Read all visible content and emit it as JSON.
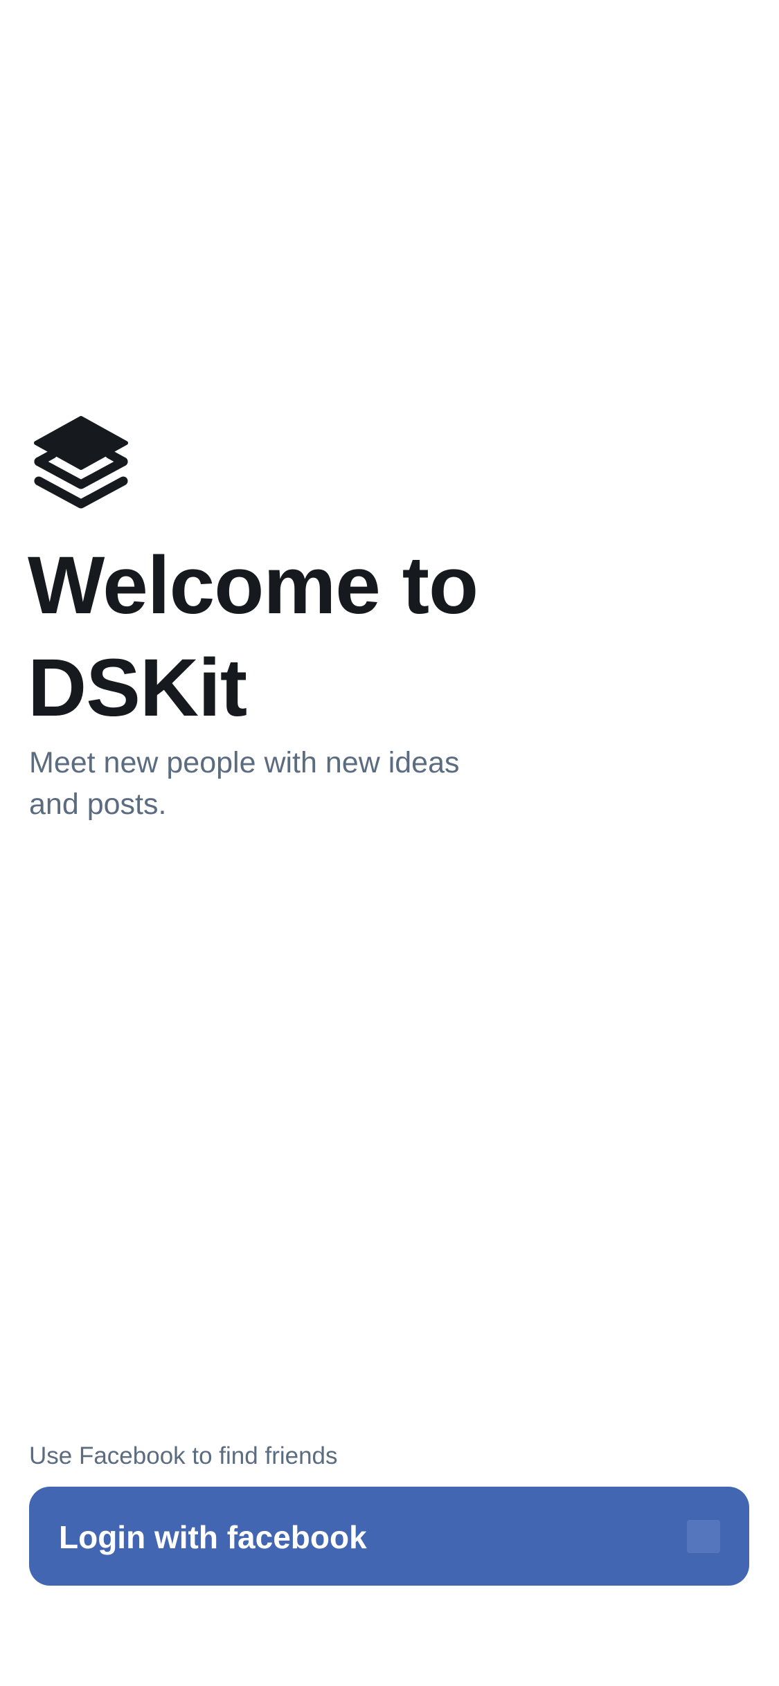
{
  "app": {
    "logo_icon": "layers-icon",
    "title_line_1": "Welcome to",
    "title_line_2": "DSKit",
    "subtitle": "Meet new people with new ideas and posts."
  },
  "login": {
    "hint": "Use Facebook to find friends",
    "button_label": "Login with facebook",
    "button_icon": "facebook-icon"
  },
  "colors": {
    "background": "#ffffff",
    "title": "#16191d",
    "secondary_text": "#5b6b80",
    "facebook_button": "#4266b2",
    "button_text": "#ffffff"
  }
}
